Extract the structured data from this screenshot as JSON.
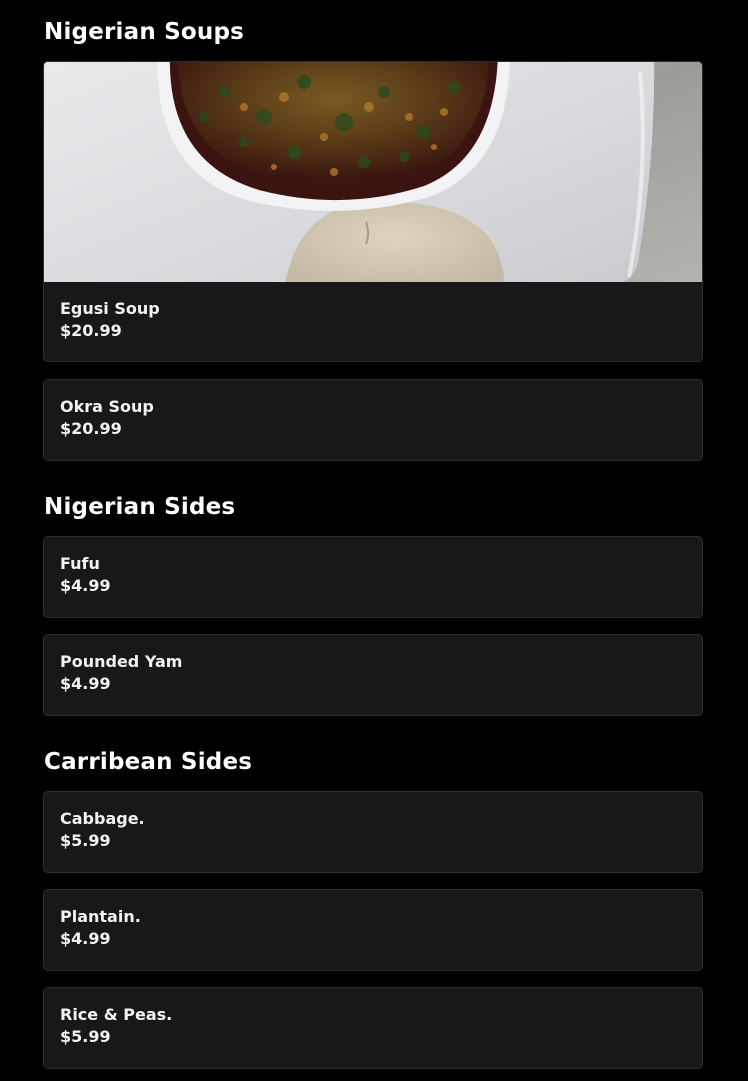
{
  "sections": [
    {
      "title": "Nigerian Soups",
      "items": [
        {
          "name": "Egusi Soup",
          "price": "$20.99",
          "image": "egusi-soup-photo"
        },
        {
          "name": "Okra Soup",
          "price": "$20.99"
        }
      ]
    },
    {
      "title": "Nigerian Sides",
      "items": [
        {
          "name": "Fufu",
          "price": "$4.99"
        },
        {
          "name": "Pounded Yam",
          "price": "$4.99"
        }
      ]
    },
    {
      "title": "Carribean Sides",
      "items": [
        {
          "name": "Cabbage.",
          "price": "$5.99"
        },
        {
          "name": "Plantain.",
          "price": "$4.99"
        },
        {
          "name": "Rice & Peas.",
          "price": "$5.99"
        }
      ]
    }
  ],
  "colors": {
    "background": "#000000",
    "card": "#181818",
    "card_border": "#2e2e2e",
    "text": "#ffffff"
  }
}
